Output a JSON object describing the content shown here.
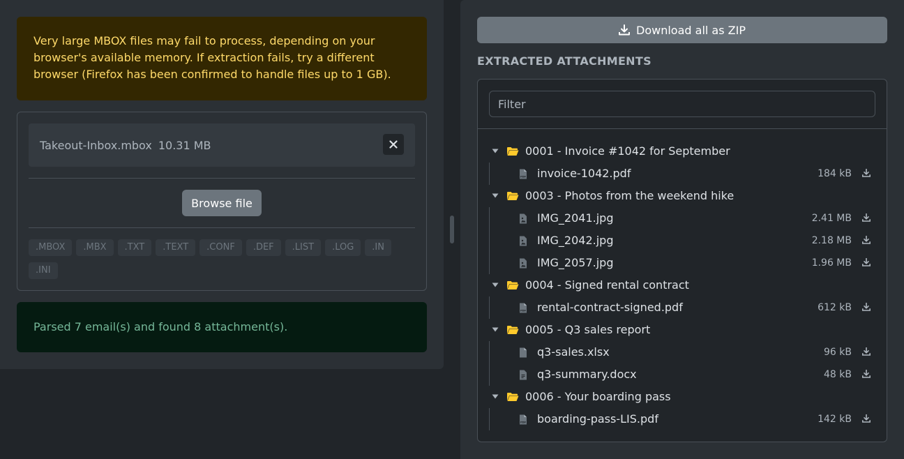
{
  "left": {
    "warning": "Very large MBOX files may fail to process, depending on your browser's available memory. If extraction fails, try a different browser (Firefox has been confirmed to handle files up to 1 GB).",
    "file": {
      "name": "Takeout-Inbox.mbox",
      "size": "10.31 MB",
      "remove_icon": "close-icon"
    },
    "browse_label": "Browse file",
    "extensions": [
      ".MBOX",
      ".MBX",
      ".TXT",
      ".TEXT",
      ".CONF",
      ".DEF",
      ".LIST",
      ".LOG",
      ".IN",
      ".INI"
    ],
    "status": "Parsed 7 email(s) and found 8 attachment(s)."
  },
  "right": {
    "zip_label": "Download all as ZIP",
    "section_title": "EXTRACTED ATTACHMENTS",
    "filter_placeholder": "Filter",
    "folders": [
      {
        "label": "0001 - Invoice #1042 for September",
        "files": [
          {
            "name": "invoice-1042.pdf",
            "size": "184 kB",
            "icon": "pdf-file-icon"
          }
        ]
      },
      {
        "label": "0003 - Photos from the weekend hike",
        "files": [
          {
            "name": "IMG_2041.jpg",
            "size": "2.41 MB",
            "icon": "image-file-icon"
          },
          {
            "name": "IMG_2042.jpg",
            "size": "2.18 MB",
            "icon": "image-file-icon"
          },
          {
            "name": "IMG_2057.jpg",
            "size": "1.96 MB",
            "icon": "image-file-icon"
          }
        ]
      },
      {
        "label": "0004 - Signed rental contract",
        "files": [
          {
            "name": "rental-contract-signed.pdf",
            "size": "612 kB",
            "icon": "pdf-file-icon"
          }
        ]
      },
      {
        "label": "0005 - Q3 sales report",
        "files": [
          {
            "name": "q3-sales.xlsx",
            "size": "96 kB",
            "icon": "file-icon"
          },
          {
            "name": "q3-summary.docx",
            "size": "48 kB",
            "icon": "text-file-icon"
          }
        ]
      },
      {
        "label": "0006 - Your boarding pass",
        "files": [
          {
            "name": "boarding-pass-LIS.pdf",
            "size": "142 kB",
            "icon": "pdf-file-icon"
          }
        ]
      }
    ]
  },
  "colors": {
    "warning_bg": "#332701",
    "warning_text": "#ffda6a",
    "success_bg": "#051b11",
    "success_text": "#75b798",
    "folder": "#ffca2c",
    "button": "#6c757d"
  }
}
